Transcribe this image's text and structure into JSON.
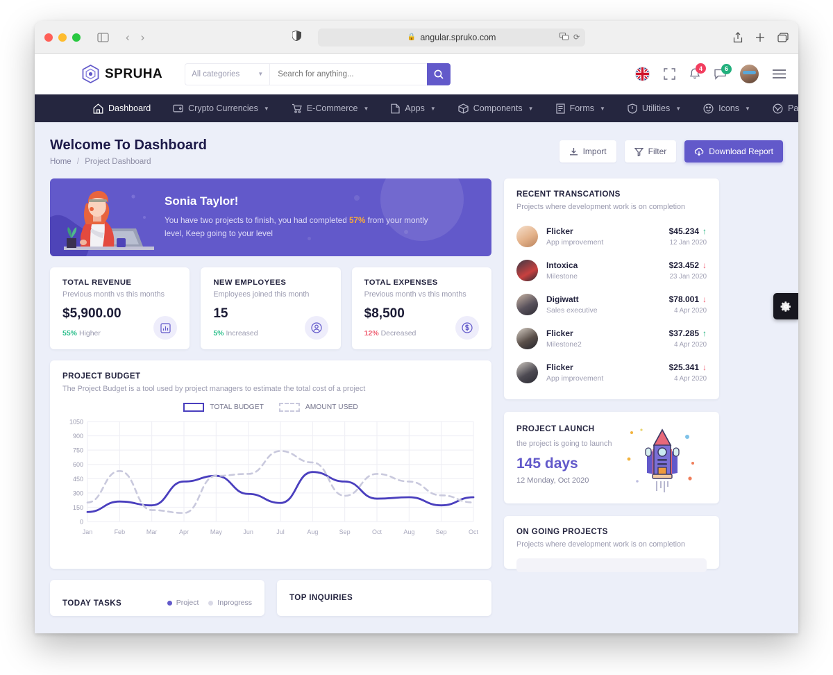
{
  "browser": {
    "url": "angular.spruko.com",
    "lock_icon": "lock-icon",
    "shield_icon": "shield-icon",
    "translate_icon": "translate-icon",
    "reload_icon": "reload-icon",
    "back_icon": "back-arrow-icon",
    "forward_icon": "forward-arrow-icon",
    "sidebar_icon": "sidebar-toggle-icon",
    "share_icon": "share-icon",
    "new_tab_icon": "new-tab-icon",
    "tabs_icon": "tab-overview-icon"
  },
  "header": {
    "brand": "SPRUHA",
    "category_value": "All categories",
    "search_placeholder": "Search for anything...",
    "search_value": "",
    "notification_badge": "4",
    "message_badge": "6",
    "flag_icon": "uk-flag-icon",
    "fullscreen_icon": "fullscreen-icon",
    "bell_icon": "bell-icon",
    "message_icon": "message-icon",
    "hamburger_icon": "hamburger-icon"
  },
  "nav": {
    "items": [
      {
        "label": "Dashboard",
        "icon": "home-icon",
        "caret": false,
        "active": true
      },
      {
        "label": "Crypto Currencies",
        "icon": "wallet-icon",
        "caret": true,
        "active": false
      },
      {
        "label": "E-Commerce",
        "icon": "cart-icon",
        "caret": true,
        "active": false
      },
      {
        "label": "Apps",
        "icon": "apps-icon",
        "caret": true,
        "active": false
      },
      {
        "label": "Components",
        "icon": "box-icon",
        "caret": true,
        "active": false
      },
      {
        "label": "Forms",
        "icon": "form-icon",
        "caret": true,
        "active": false
      },
      {
        "label": "Utilities",
        "icon": "shield-icon",
        "caret": true,
        "active": false
      },
      {
        "label": "Icons",
        "icon": "smiley-icon",
        "caret": true,
        "active": false
      },
      {
        "label": "Pages",
        "icon": "pages-icon",
        "caret": true,
        "active": false
      }
    ]
  },
  "page": {
    "title": "Welcome To Dashboard",
    "breadcrumb_home": "Home",
    "breadcrumb_sep": "/",
    "breadcrumb_current": "Project Dashboard",
    "actions": {
      "import": "Import",
      "filter": "Filter",
      "download": "Download Report"
    },
    "settings_tab_icon": "gear-icon"
  },
  "banner": {
    "name": "Sonia Taylor!",
    "text_before": "You have two projects to finish, you had completed ",
    "percent": "57%",
    "text_after": " from your montly level, Keep going to your level",
    "accent": "#6259ca"
  },
  "stats": [
    {
      "title": "TOTAL REVENUE",
      "subtitle": "Previous month vs this months",
      "value": "$5,900.00",
      "delta": "55%",
      "delta_label": "Higher",
      "direction": "up",
      "icon": "bar-chart-icon"
    },
    {
      "title": "NEW EMPLOYEES",
      "subtitle": "Employees joined this month",
      "value": "15",
      "delta": "5%",
      "delta_label": "Increased",
      "direction": "up",
      "icon": "user-icon"
    },
    {
      "title": "TOTAL EXPENSES",
      "subtitle": "Previous month vs this months",
      "value": "$8,500",
      "delta": "12%",
      "delta_label": "Decreased",
      "direction": "down",
      "icon": "dollar-icon"
    }
  ],
  "budget": {
    "title": "PROJECT BUDGET",
    "subtitle": "The Project Budget is a tool used by project managers to estimate the total cost of a project",
    "legend": [
      {
        "label": "TOTAL BUDGET",
        "style": "solid",
        "color": "#4a3fbe"
      },
      {
        "label": "AMOUNT USED",
        "style": "dashed",
        "color": "#c9c9dd"
      }
    ]
  },
  "chart_data": {
    "type": "line",
    "title": "PROJECT BUDGET",
    "xlabel": "",
    "ylabel": "",
    "ylim": [
      0,
      1050
    ],
    "yticks": [
      0,
      150,
      300,
      450,
      600,
      750,
      900,
      1050
    ],
    "grid": true,
    "legend_position": "top-center",
    "categories": [
      "Jan",
      "Feb",
      "Mar",
      "Apr",
      "May",
      "Jun",
      "Jul",
      "Aug",
      "Sep",
      "Oct",
      "Aug",
      "Sep",
      "Oct"
    ],
    "series": [
      {
        "name": "TOTAL BUDGET",
        "style": "solid",
        "color": "#4a3fbe",
        "values": [
          100,
          210,
          170,
          420,
          480,
          290,
          195,
          520,
          420,
          240,
          255,
          170,
          255
        ]
      },
      {
        "name": "AMOUNT USED",
        "style": "dashed",
        "color": "#c9c9dd",
        "values": [
          200,
          530,
          120,
          90,
          480,
          500,
          740,
          620,
          270,
          500,
          420,
          275,
          200
        ]
      }
    ]
  },
  "transactions": {
    "title": "RECENT TRANSCATIONS",
    "subtitle": "Projects where development work is on completion",
    "rows": [
      {
        "name": "Flicker",
        "role": "App improvement",
        "amount": "$45.234",
        "date": "12 Jan 2020",
        "direction": "up",
        "avatar_colors": [
          "#f3d9c6",
          "#d9a87e"
        ]
      },
      {
        "name": "Intoxica",
        "role": "Milestone",
        "amount": "$23.452",
        "date": "23 Jan 2020",
        "direction": "down",
        "avatar_colors": [
          "#d64a4a",
          "#2b2b35"
        ]
      },
      {
        "name": "Digiwatt",
        "role": "Sales executive",
        "amount": "$78.001",
        "date": "4 Apr 2020",
        "direction": "down",
        "avatar_colors": [
          "#cbb9a9",
          "#3c3a45"
        ]
      },
      {
        "name": "Flicker",
        "role": "Milestone2",
        "amount": "$37.285",
        "date": "4 Apr 2020",
        "direction": "up",
        "avatar_colors": [
          "#cfc6bd",
          "#26262e"
        ]
      },
      {
        "name": "Flicker",
        "role": "App improvement",
        "amount": "$25.341",
        "date": "4 Apr 2020",
        "direction": "down",
        "avatar_colors": [
          "#c9c3bb",
          "#33333d"
        ]
      }
    ]
  },
  "launch": {
    "title": "PROJECT LAUNCH",
    "subtitle": "the project is going to launch",
    "days": "145 days",
    "date": "12 Monday, Oct 2020",
    "art": "rocket-illustration"
  },
  "ongoing": {
    "title": "ON GOING PROJECTS",
    "subtitle": "Projects where development work is on completion"
  },
  "today_tasks": {
    "title": "TODAY TASKS",
    "legend": [
      {
        "label": "Project",
        "color": "#6259ca"
      },
      {
        "label": "Inprogress",
        "color": "#d9d9e6"
      }
    ]
  },
  "top_inquiries": {
    "title": "TOP INQUIRIES"
  }
}
